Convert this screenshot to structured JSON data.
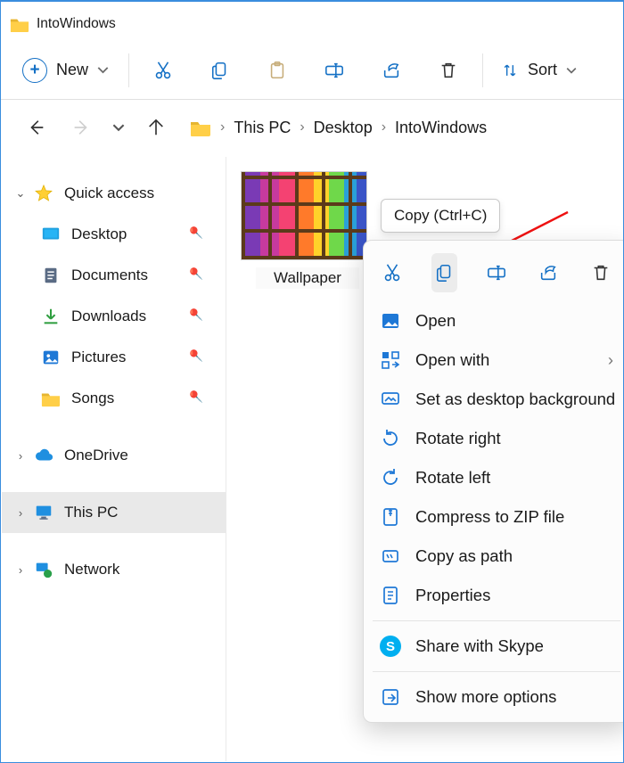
{
  "title": "IntoWindows",
  "toolbar": {
    "new_label": "New",
    "sort_label": "Sort"
  },
  "breadcrumb": {
    "items": [
      "This PC",
      "Desktop",
      "IntoWindows"
    ]
  },
  "sidebar": {
    "quick_access": "Quick access",
    "items": [
      {
        "label": "Desktop",
        "icon": "desktop"
      },
      {
        "label": "Documents",
        "icon": "documents"
      },
      {
        "label": "Downloads",
        "icon": "downloads"
      },
      {
        "label": "Pictures",
        "icon": "pictures"
      },
      {
        "label": "Songs",
        "icon": "folder"
      }
    ],
    "onedrive": "OneDrive",
    "this_pc": "This PC",
    "network": "Network"
  },
  "content": {
    "selected_file": "Wallpaper"
  },
  "tooltip": "Copy (Ctrl+C)",
  "context_menu": {
    "icon_row": [
      "cut",
      "copy",
      "rename",
      "share",
      "delete"
    ],
    "items": [
      {
        "icon": "photo",
        "label": "Open"
      },
      {
        "icon": "openwith",
        "label": "Open with"
      },
      {
        "icon": "setbg",
        "label": "Set as desktop background"
      },
      {
        "icon": "rotr",
        "label": "Rotate right"
      },
      {
        "icon": "rotl",
        "label": "Rotate left"
      },
      {
        "icon": "zip",
        "label": "Compress to ZIP file"
      },
      {
        "icon": "path",
        "label": "Copy as path"
      },
      {
        "icon": "prop",
        "label": "Properties"
      }
    ],
    "share_skype": "Share with Skype",
    "more": "Show more options"
  }
}
